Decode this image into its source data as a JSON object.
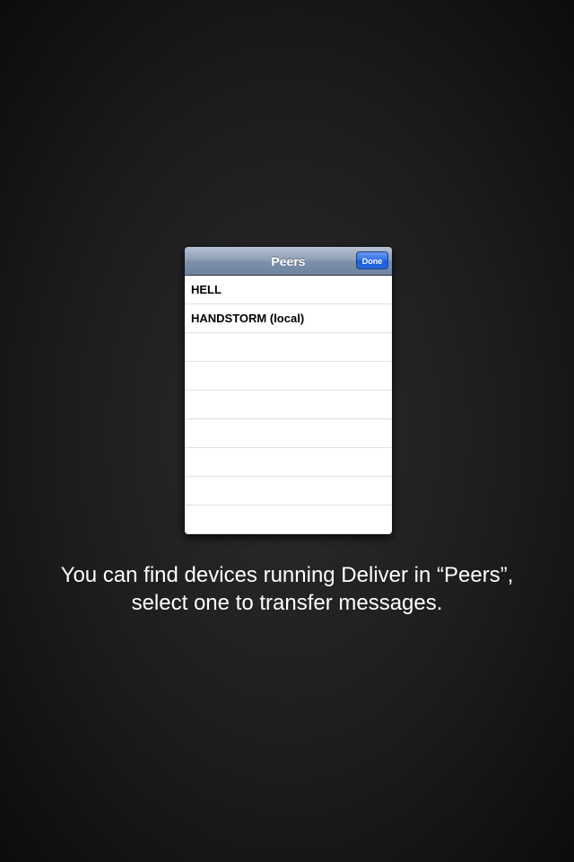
{
  "panel": {
    "title": "Peers",
    "done_label": "Done",
    "rows": [
      "HELL",
      "HANDSTORM (local)",
      "",
      "",
      "",
      "",
      "",
      "",
      ""
    ]
  },
  "caption": {
    "line1": "You can find devices running Deliver in “Peers”,",
    "line2": "select one to transfer messages."
  }
}
